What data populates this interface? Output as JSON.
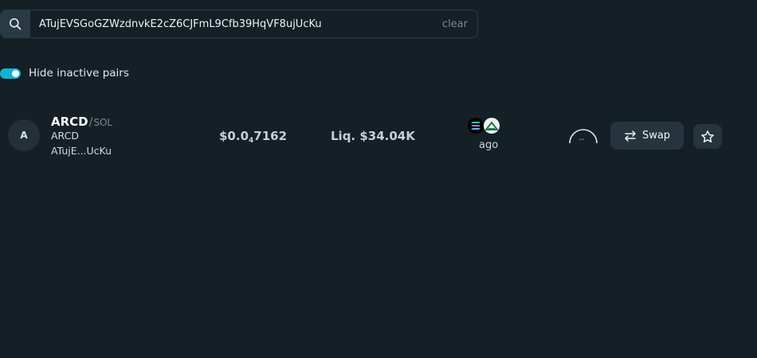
{
  "search": {
    "value": "ATujEVSGoGZWzdnvkE2cZ6CJFmL9Cfb39HqVF8ujUcKu",
    "clear_label": "clear",
    "icon": "search-icon"
  },
  "filters": {
    "hide_inactive_label": "Hide inactive pairs",
    "hide_inactive_enabled": true,
    "toggle_color": "#12b3d2"
  },
  "pair": {
    "avatar_letter": "A",
    "base_symbol": "ARCD",
    "separator": "/",
    "quote_symbol": "SOL",
    "token_name": "ARCD",
    "token_address_short": "ATujE...UcKu",
    "price_prefix": "$0.0",
    "price_zero_count": "4",
    "price_digits": "7162",
    "liquidity": "Liq. $34.04K",
    "chain_icon": "solana-icon",
    "dex_icon": "raydium-icon",
    "age": "ago",
    "gauge_value": "--",
    "swap_label": "Swap",
    "swap_icon": "swap-arrows-icon",
    "favorite_icon": "star-icon"
  },
  "colors": {
    "background": "#141f26",
    "button_bg": "#26343e",
    "accent": "#12b3d2"
  }
}
